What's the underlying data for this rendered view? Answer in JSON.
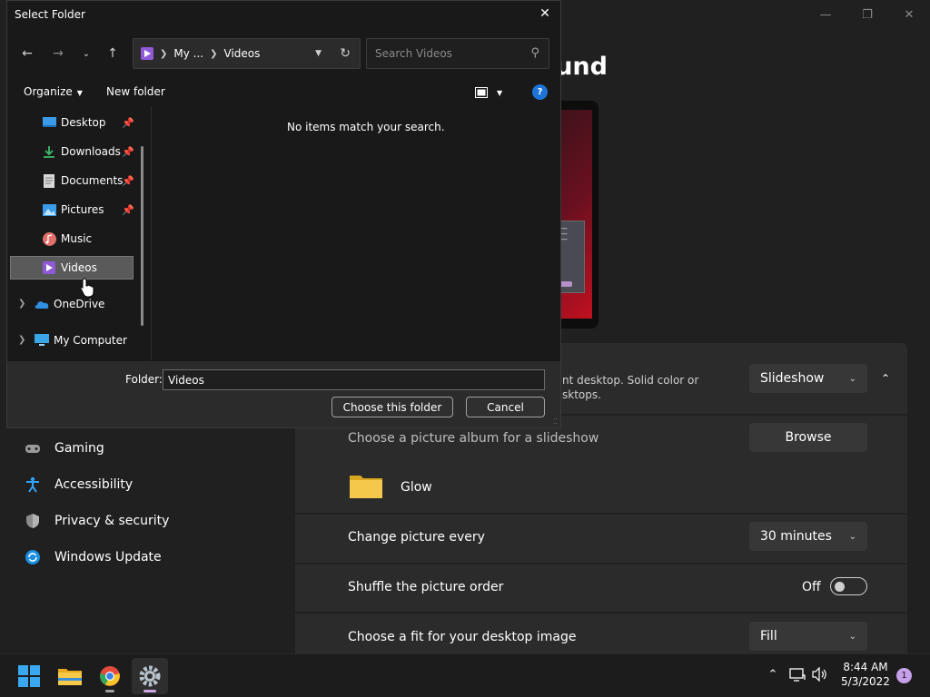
{
  "dialog": {
    "title": "Select Folder",
    "address_parts": [
      "My ...",
      "Videos"
    ],
    "search_placeholder": "Search Videos",
    "organize_label": "Organize",
    "new_folder_label": "New folder",
    "help_glyph": "?",
    "tree": [
      {
        "label": "Desktop",
        "icon": "desktop-icon",
        "pinned": true
      },
      {
        "label": "Downloads",
        "icon": "download-icon",
        "pinned": true
      },
      {
        "label": "Documents",
        "icon": "documents-icon",
        "pinned": true
      },
      {
        "label": "Pictures",
        "icon": "pictures-icon",
        "pinned": true
      },
      {
        "label": "Music",
        "icon": "music-icon",
        "pinned": false
      },
      {
        "label": "Videos",
        "icon": "videos-icon",
        "pinned": false,
        "selected": true
      },
      {
        "label": "OneDrive",
        "icon": "onedrive-icon",
        "expandable": true
      },
      {
        "label": "My Computer",
        "icon": "computer-icon",
        "expandable": true
      }
    ],
    "empty_message": "No items match your search.",
    "folder_label": "Folder:",
    "folder_value": "Videos",
    "choose_button": "Choose this folder",
    "cancel_button": "Cancel"
  },
  "settings": {
    "heading_fragment": "ground",
    "background_desc_line1": "nt desktop. Solid color or",
    "background_desc_line2": "sktops.",
    "background_type_value": "Slideshow",
    "album_label": "Choose a picture album for a slideshow",
    "browse_label": "Browse",
    "album_folder_name": "Glow",
    "change_every_label": "Change picture every",
    "change_every_value": "30 minutes",
    "shuffle_label": "Shuffle the picture order",
    "shuffle_state": "Off",
    "fit_label": "Choose a fit for your desktop image",
    "fit_value": "Fill"
  },
  "nav": [
    {
      "label": "Gaming",
      "icon": "gamepad-icon"
    },
    {
      "label": "Accessibility",
      "icon": "accessibility-icon"
    },
    {
      "label": "Privacy & security",
      "icon": "shield-icon"
    },
    {
      "label": "Windows Update",
      "icon": "update-icon"
    }
  ],
  "taskbar": {
    "apps": [
      "start-icon",
      "file-explorer-icon",
      "chrome-icon",
      "settings-icon"
    ],
    "time": "8:44 AM",
    "date": "5/3/2022",
    "notification_count": "1"
  },
  "colors": {
    "accent": "#1e74d8",
    "toggle_off": "#cfcfcf",
    "selection": "#5a5a5a"
  }
}
